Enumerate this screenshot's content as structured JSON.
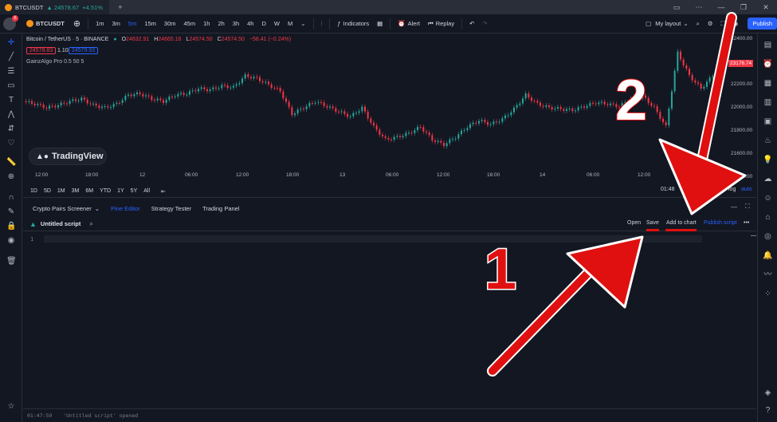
{
  "titlebar": {
    "tab_symbol": "BTCUSDT",
    "tab_price": "▲ 24578.67",
    "tab_change": "+4.51%",
    "window_buttons": [
      "—",
      "❐",
      "✕"
    ]
  },
  "toolbar": {
    "notification_count": "6",
    "symbol": "BTCUSDT",
    "intervals": [
      "1m",
      "3m",
      "5m",
      "15m",
      "30m",
      "45m",
      "1h",
      "2h",
      "3h",
      "4h",
      "D",
      "W",
      "M"
    ],
    "active_interval": "5m",
    "indicators_label": "Indicators",
    "alert_label": "Alert",
    "replay_label": "Replay",
    "layout_label": "My layout",
    "publish_label": "Publish"
  },
  "chart": {
    "title": "Bitcoin / TetherUS · 5 · BINANCE",
    "ohlc": {
      "o_label": "O",
      "o": "24632.91",
      "h_label": "H",
      "h": "24665.16",
      "l_label": "L",
      "l": "24574.50",
      "c_label": "C",
      "c": "24574.50",
      "change": "−58.41 (−0.24%)"
    },
    "bid": "24578.83",
    "spread": "1.10",
    "ask": "24579.93",
    "indicator": "GainzAlgo Pro",
    "indicator_params": "0.5 50 5",
    "logo_text": "TradingView",
    "last_price": "23176.74",
    "y_labels": [
      "22400.00",
      "22200.00",
      "22000.00",
      "21800.00",
      "21600.00",
      "21400.00"
    ],
    "x_labels": [
      "12:00",
      "18:00",
      "12",
      "06:00",
      "12:00",
      "18:00",
      "13",
      "06:00",
      "12:00",
      "18:00",
      "14",
      "06:00",
      "12:00"
    ],
    "time": "01:48",
    "percent_label": "%",
    "log_label": "log",
    "auto_label": "auto"
  },
  "chart_data": {
    "type": "line",
    "title": "Bitcoin / TetherUS · 5 · BINANCE",
    "xlabel": "",
    "ylabel": "",
    "ylim": [
      21400,
      22400
    ],
    "y": [
      21900,
      21880,
      21850,
      21870,
      21900,
      21920,
      21870,
      21850,
      21880,
      21950,
      21960,
      21920,
      21900,
      21950,
      21960,
      22000,
      21990,
      22020,
      22010,
      22100,
      22080,
      22030,
      21980,
      21800,
      21850,
      21900,
      21860,
      21820,
      21780,
      21850,
      21700,
      21600,
      21620,
      21650,
      21700,
      21600,
      21560,
      21620,
      21700,
      21750,
      21720,
      21760,
      21840,
      21950,
      21880,
      21850,
      21840,
      21830,
      21860,
      21890,
      21880,
      21860,
      21920,
      21940,
      21850,
      21700,
      22280,
      22100,
      22000,
      22100,
      22150
    ]
  },
  "rangebar": {
    "ranges": [
      "1D",
      "5D",
      "1M",
      "3M",
      "6M",
      "YTD",
      "1Y",
      "5Y",
      "All"
    ]
  },
  "bottom_panel": {
    "tabs": [
      "Crypto Pairs Screener",
      "Pine Editor",
      "Strategy Tester",
      "Trading Panel"
    ],
    "active_tab": "Pine Editor",
    "script_title": "Untitled script",
    "open_label": "Open",
    "save_label": "Save",
    "add_to_chart_label": "Add to chart",
    "publish_script_label": "Publish script",
    "line_number": "1",
    "console_time": "01:47:59",
    "console_message": "'Untitled script' opened"
  },
  "annotations": {
    "label_1": "1",
    "label_2": "2",
    "arrow_color": "#e01010"
  },
  "colors": {
    "background": "#131722",
    "up": "#26a69a",
    "down": "#f23645",
    "accent": "#2962ff"
  }
}
